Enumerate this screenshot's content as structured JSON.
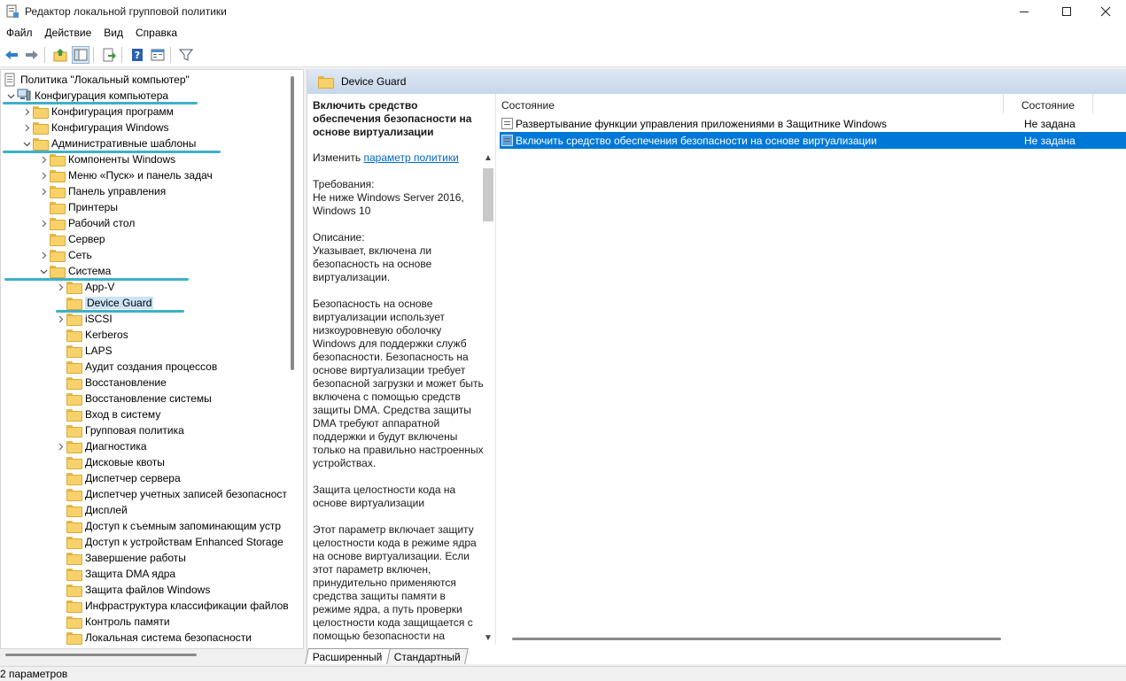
{
  "window": {
    "title": "Редактор локальной групповой политики",
    "icon": "policy-editor-icon",
    "controls": [
      "minimize-icon",
      "maximize-icon",
      "close-icon"
    ]
  },
  "menu": [
    "Файл",
    "Действие",
    "Вид",
    "Справка"
  ],
  "toolbar": {
    "buttons": [
      "back-arrow-icon",
      "forward-arrow-icon",
      "up-folder-icon",
      "show-tree-icon",
      "export-list-icon",
      "help-icon",
      "properties-icon",
      "filter-icon"
    ]
  },
  "tree": {
    "root": "Политика \"Локальный компьютер\"",
    "items": [
      {
        "label": "Конфигурация компьютера",
        "level": 1,
        "expander": "expanded",
        "icon": "computer-icon"
      },
      {
        "label": "Конфигурация программ",
        "level": 2,
        "expander": "collapsed"
      },
      {
        "label": "Конфигурация Windows",
        "level": 2,
        "expander": "collapsed"
      },
      {
        "label": "Административные шаблоны",
        "level": 2,
        "expander": "expanded"
      },
      {
        "label": "Компоненты Windows",
        "level": 3,
        "expander": "collapsed"
      },
      {
        "label": "Меню «Пуск» и панель задач",
        "level": 3,
        "expander": "collapsed"
      },
      {
        "label": "Панель управления",
        "level": 3,
        "expander": "collapsed"
      },
      {
        "label": "Принтеры",
        "level": 3,
        "expander": "none"
      },
      {
        "label": "Рабочий стол",
        "level": 3,
        "expander": "collapsed"
      },
      {
        "label": "Сервер",
        "level": 3,
        "expander": "none"
      },
      {
        "label": "Сеть",
        "level": 3,
        "expander": "collapsed"
      },
      {
        "label": "Система",
        "level": 3,
        "expander": "expanded"
      },
      {
        "label": "App-V",
        "level": 4,
        "expander": "collapsed"
      },
      {
        "label": "Device Guard",
        "level": 4,
        "expander": "none",
        "selected": true
      },
      {
        "label": "iSCSI",
        "level": 4,
        "expander": "collapsed"
      },
      {
        "label": "Kerberos",
        "level": 4,
        "expander": "none"
      },
      {
        "label": "LAPS",
        "level": 4,
        "expander": "none"
      },
      {
        "label": "Аудит создания процессов",
        "level": 4,
        "expander": "none"
      },
      {
        "label": "Восстановление",
        "level": 4,
        "expander": "none"
      },
      {
        "label": "Восстановление системы",
        "level": 4,
        "expander": "none"
      },
      {
        "label": "Вход в систему",
        "level": 4,
        "expander": "none"
      },
      {
        "label": "Групповая политика",
        "level": 4,
        "expander": "none"
      },
      {
        "label": "Диагностика",
        "level": 4,
        "expander": "collapsed"
      },
      {
        "label": "Дисковые квоты",
        "level": 4,
        "expander": "none"
      },
      {
        "label": "Диспетчер сервера",
        "level": 4,
        "expander": "none"
      },
      {
        "label": "Диспетчер учетных записей безопасност",
        "level": 4,
        "expander": "none"
      },
      {
        "label": "Дисплей",
        "level": 4,
        "expander": "none"
      },
      {
        "label": "Доступ к съемным запоминающим устр",
        "level": 4,
        "expander": "none"
      },
      {
        "label": "Доступ к устройствам Enhanced Storage",
        "level": 4,
        "expander": "none"
      },
      {
        "label": "Завершение работы",
        "level": 4,
        "expander": "none"
      },
      {
        "label": "Защита DMA ядра",
        "level": 4,
        "expander": "none"
      },
      {
        "label": "Защита файлов Windows",
        "level": 4,
        "expander": "none"
      },
      {
        "label": "Инфраструктура классификации файлов",
        "level": 4,
        "expander": "none"
      },
      {
        "label": "Контроль памяти",
        "level": 4,
        "expander": "none"
      },
      {
        "label": "Локальная система безопасности",
        "level": 4,
        "expander": "none"
      }
    ]
  },
  "header": {
    "title": "Device Guard"
  },
  "description": {
    "title": "Включить средство обеспечения безопасности на основе виртуализации",
    "edit_prefix": "Изменить ",
    "edit_link": "параметр политики",
    "requirements_label": "Требования:",
    "requirements": "Не ниже Windows Server 2016, Windows 10",
    "description_label": "Описание:",
    "p1": "Указывает, включена ли безопасность на основе виртуализации.",
    "p2": "Безопасность на основе виртуализации использует низкоуровневую оболочку Windows для поддержки служб безопасности. Безопасность на основе виртуализации требует безопасной загрузки и может быть включена с помощью средств защиты DMA. Средства защиты DMA требуют аппаратной поддержки и будут включены только на правильно настроенных устройствах.",
    "p3": "Защита целостности кода на основе виртуализации",
    "p4": "Этот параметр включает защиту целостности кода в режиме ядра на основе виртуализации. Если этот параметр включен, принудительно применяются средства защиты памяти в режиме ядра, а путь проверки целостности кода защищается с помощью безопасности на"
  },
  "list": {
    "columns": [
      "Состояние",
      "Состояние"
    ],
    "rows": [
      {
        "name": "Развертывание функции управления приложениями в Защитнике Windows",
        "state": "Не задана",
        "selected": false
      },
      {
        "name": "Включить средство обеспечения безопасности на основе виртуализации",
        "state": "Не задана",
        "selected": true
      }
    ]
  },
  "tabs": [
    {
      "label": "Расширенный",
      "active": true
    },
    {
      "label": "Стандартный",
      "active": false
    }
  ],
  "status": "2 параметров",
  "colors": {
    "selection": "#0078d7",
    "tree_highlight": "#3fb0c8",
    "link": "#0066cc",
    "folder": "#f7d26b"
  }
}
